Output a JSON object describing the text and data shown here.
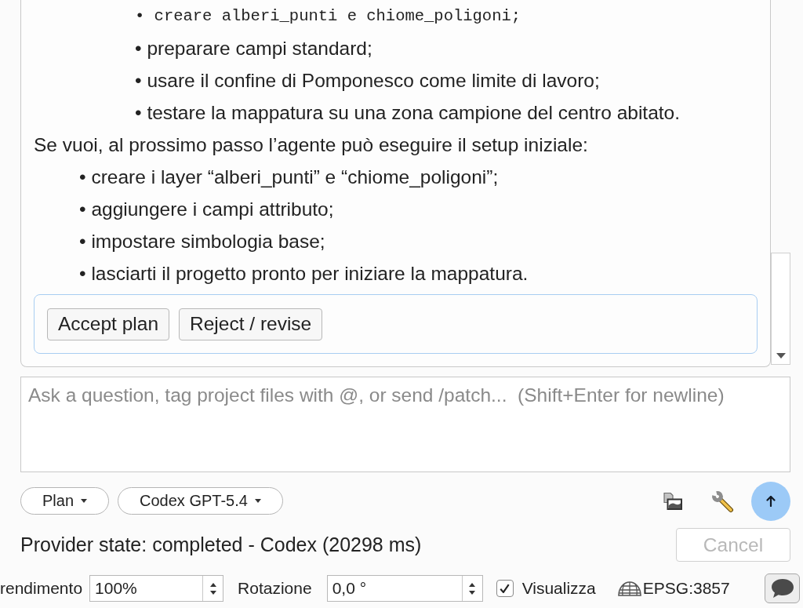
{
  "chat": {
    "blocks": [
      {
        "kind": "sublist",
        "items": [
          {
            "kind": "code",
            "text": "• creare alberi_punti e chiome_poligoni;"
          },
          {
            "kind": "text",
            "text": "• preparare campi standard;"
          },
          {
            "kind": "text",
            "text": "• usare il confine di Pomponesco come limite di lavoro;"
          },
          {
            "kind": "text",
            "text": "• testare la mappatura su una zona campione del centro abitato."
          }
        ]
      },
      {
        "kind": "paragraph",
        "text": "Se vuoi, al prossimo passo l’agente può eseguire il setup iniziale:"
      },
      {
        "kind": "list",
        "items": [
          {
            "kind": "text",
            "text": "• creare i layer “alberi_punti” e “chiome_poligoni”;"
          },
          {
            "kind": "text",
            "text": "• aggiungere i campi attributo;"
          },
          {
            "kind": "text",
            "text": "• impostare simbologia base;"
          },
          {
            "kind": "text",
            "text": "• lasciarti il progetto pronto per iniziare la mappatura."
          }
        ]
      }
    ],
    "actions": [
      {
        "label": "Accept plan"
      },
      {
        "label": "Reject / revise"
      }
    ]
  },
  "composer": {
    "placeholder": "Ask a question, tag project files with @, or send /patch...  (Shift+Enter for newline)"
  },
  "toolbar": {
    "dropdowns": [
      {
        "label": "Plan"
      },
      {
        "label": "Codex GPT-5.4"
      }
    ]
  },
  "status": {
    "text": "Provider state: completed - Codex (20298 ms)",
    "cancel": {
      "label": "Cancel",
      "disabled": true
    }
  },
  "status_bar": {
    "magnifier": {
      "label": "rendimento",
      "value": "100%"
    },
    "rotation": {
      "label": "Rotazione",
      "value": "0,0 °"
    },
    "render": {
      "label": "Visualizza",
      "checked": true
    },
    "crs": "EPSG:3857"
  }
}
